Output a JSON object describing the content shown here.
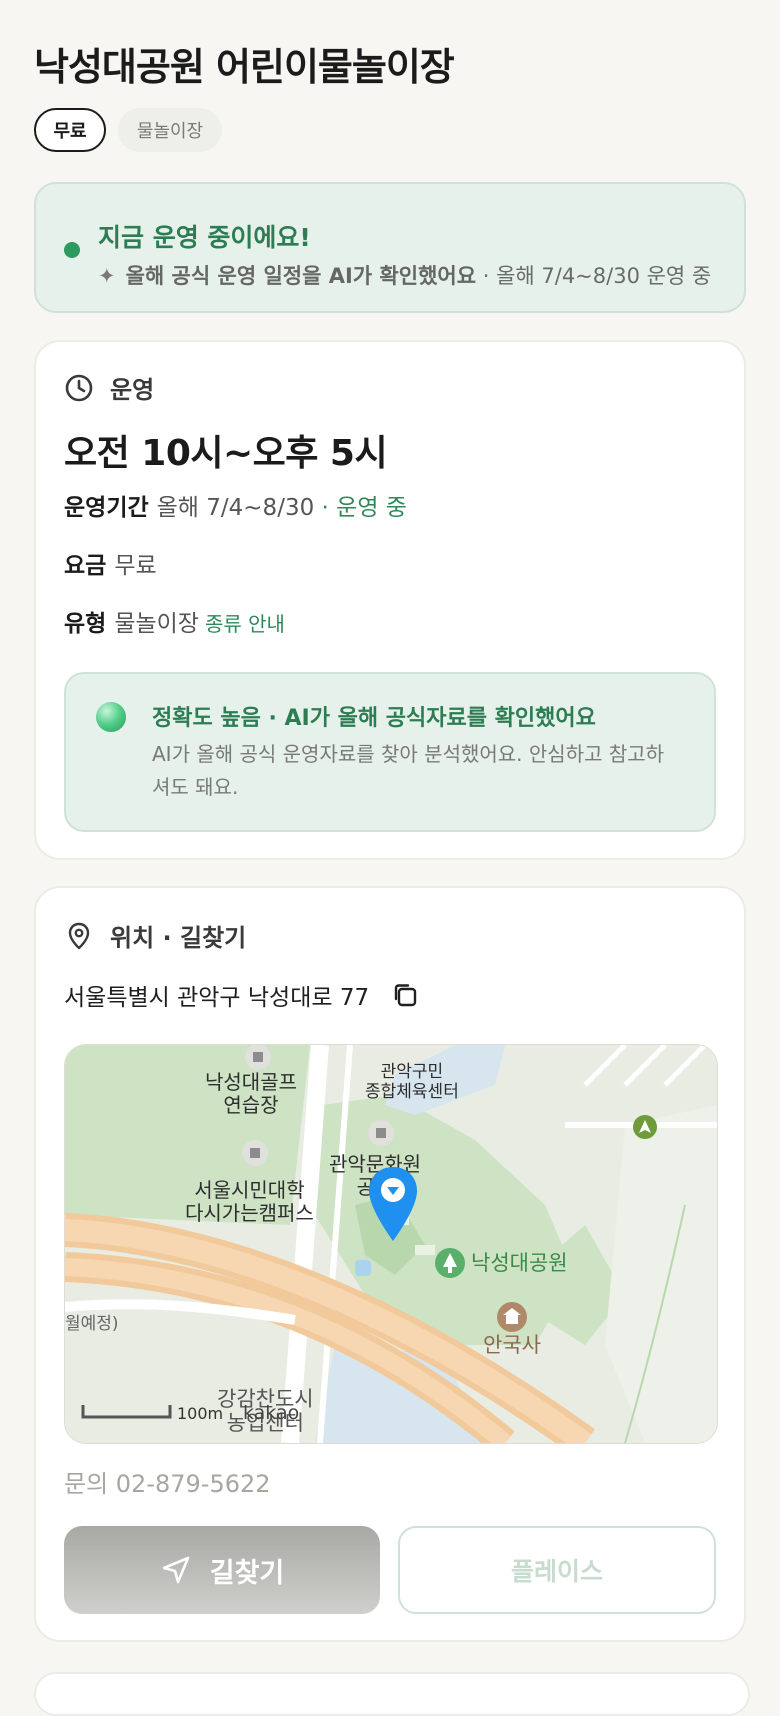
{
  "header": {
    "title": "낙성대공원 어린이물놀이장",
    "chips": [
      "무료",
      "물놀이장"
    ]
  },
  "status": {
    "title": "지금 운영 중이에요!",
    "ai_note": "올해 공식 운영 일정을 AI가 확인했어요",
    "period": "· 올해 7/4~8/30 운영 중"
  },
  "operation": {
    "section_title": "운영",
    "hours": "오전 10시~오후 5시",
    "period_label": "운영기간",
    "period_value": "올해 7/4~8/30",
    "period_status": "· 운영 중",
    "fee_label": "요금",
    "fee_value": "무료",
    "type_label": "유형",
    "type_value": "물놀이장",
    "type_link": "종류 안내",
    "ai_title": "정확도 높음 · AI가 올해 공식자료를 확인했어요",
    "ai_desc": "AI가 올해 공식 운영자료를 찾아 분석했어요. 안심하고 참고하셔도 돼요."
  },
  "location": {
    "section_title": "위치 · 길찾기",
    "address": "서울특별시 관악구 낙성대로 77",
    "map_labels": {
      "golf": "낙성대골프\n연습장",
      "gym": "관악구민\n종합체육센터",
      "culture": "관악문화원\n공원",
      "univ": "서울시민대학\n다시가는캠퍼스",
      "park": "낙성대공원",
      "temple": "안국사",
      "planned": "월예정)",
      "center": "강감찬도시\n농업센터",
      "scale": "100m",
      "brand": "kakao"
    },
    "phone": "문의 02-879-5622",
    "directions_button": "길찾기",
    "places_button": "플레이스"
  },
  "colors": {
    "accent_green": "#2d8a58",
    "card_tint": "#e6f1eb",
    "marker_blue": "#1f8ff0"
  }
}
